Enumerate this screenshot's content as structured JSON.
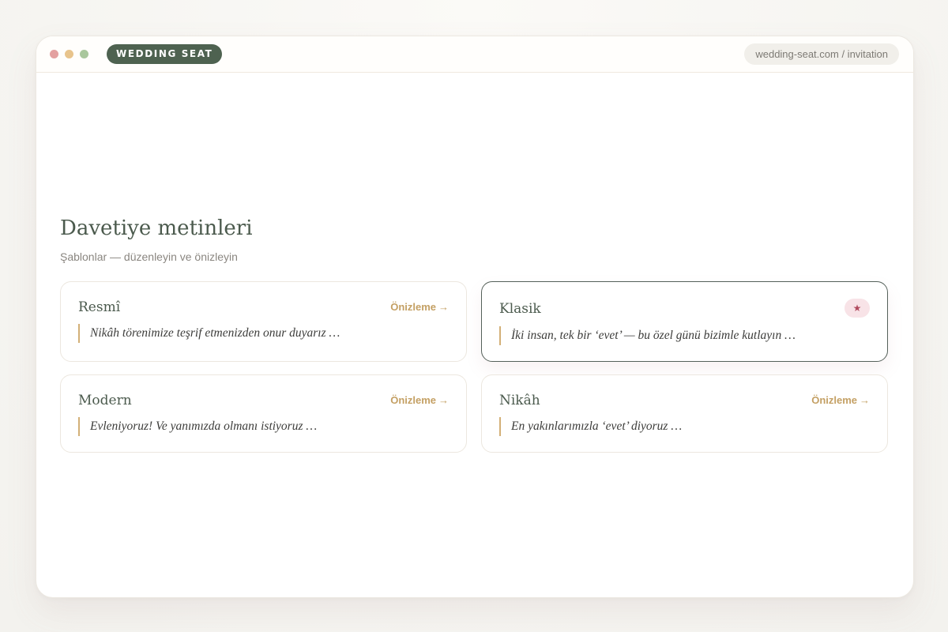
{
  "window": {
    "brand": "WEDDING SEAT",
    "url": "wedding-seat.com / invitation"
  },
  "page": {
    "title": "Davetiye metinleri",
    "subtitle": "Şablonlar — düzenleyin ve önizleyin"
  },
  "templates": [
    {
      "name": "Resmî",
      "preview_label": "Önizleme",
      "arrow": "→",
      "text": "Nikâh törenimize teşrif etmenizden onur duyarız …",
      "selected": false
    },
    {
      "name": "Klasik",
      "badge": "★",
      "text": "İki insan, tek bir ‘evet’ — bu özel günü bizimle kutlayın …",
      "selected": true
    },
    {
      "name": "Modern",
      "preview_label": "Önizleme",
      "arrow": "→",
      "text": "Evleniyoruz! Ve yanımızda olmanı istiyoruz …",
      "selected": false
    },
    {
      "name": "Nikâh",
      "preview_label": "Önizleme",
      "arrow": "→",
      "text": "En yakınlarımızla ‘evet’ diyoruz …",
      "selected": false
    }
  ],
  "colors": {
    "accent_green": "#4e6250",
    "accent_gold": "#c4a064",
    "star_pink": "#b04a5e"
  }
}
